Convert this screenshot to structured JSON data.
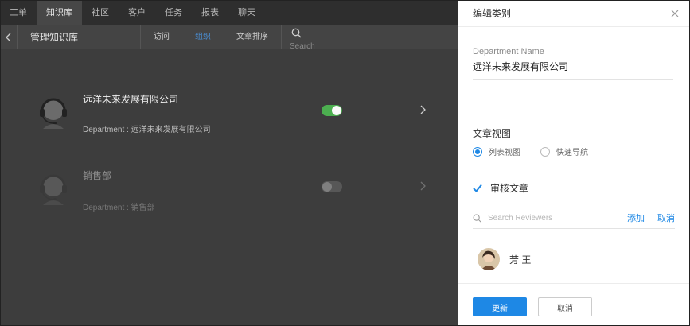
{
  "topnav": {
    "items": [
      {
        "label": "工单"
      },
      {
        "label": "知识库"
      },
      {
        "label": "社区"
      },
      {
        "label": "客户"
      },
      {
        "label": "任务"
      },
      {
        "label": "报表"
      },
      {
        "label": "聊天"
      }
    ],
    "active_index": 1
  },
  "subbar": {
    "title": "管理知识库",
    "tabs": [
      {
        "label": "访问"
      },
      {
        "label": "组织"
      },
      {
        "label": "文章排序"
      }
    ],
    "active_tab_index": 1,
    "search_placeholder": "Search"
  },
  "list": {
    "items": [
      {
        "name": "远洋未来发展有限公司",
        "dept": "Department : 远洋未来发展有限公司",
        "enabled": true
      },
      {
        "name": "销售部",
        "dept": "Department : 销售部",
        "enabled": false
      }
    ]
  },
  "panel": {
    "title": "编辑类别",
    "field_label": "Department Name",
    "field_value": "远洋未来发展有限公司",
    "view_label": "文章视图",
    "view_options": [
      {
        "label": "列表视图",
        "selected": true
      },
      {
        "label": "快速导航",
        "selected": false
      }
    ],
    "review_label": "审核文章",
    "review_checked": true,
    "reviewer_search_placeholder": "Search Reviewers",
    "add_label": "添加",
    "cancel_link_label": "取消",
    "reviewers": [
      {
        "name": "芳 王"
      }
    ],
    "update_button": "更新",
    "cancel_button": "取消"
  },
  "colors": {
    "accent": "#1e88e5",
    "toggle_on": "#4caf50",
    "topnav_bg": "#2e2e2e"
  }
}
